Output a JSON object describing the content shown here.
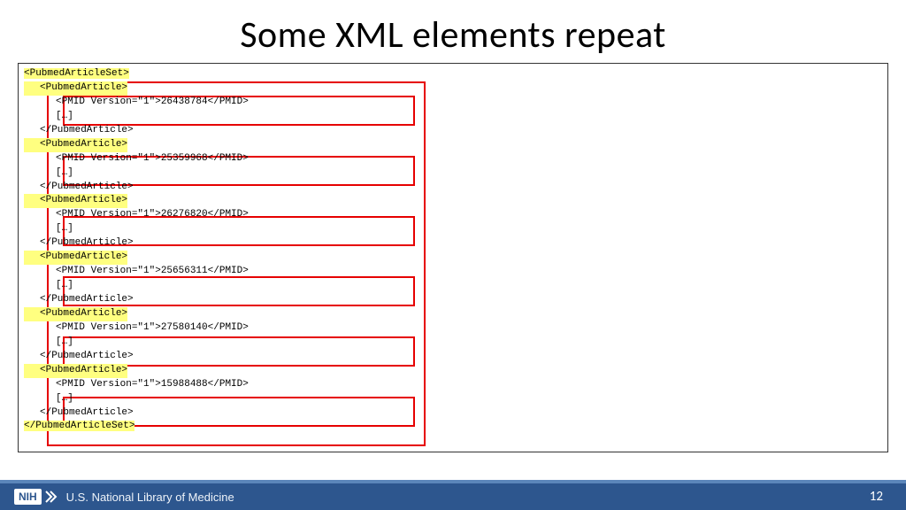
{
  "title": "Some XML elements repeat",
  "xml": {
    "setOpen": "<PubmedArticleSet>",
    "setClose": "</PubmedArticleSet>",
    "articleOpen": "<PubmedArticle>",
    "articleClose": "</PubmedArticle>",
    "pmidOpen": "<PMID Version=\"1\">",
    "pmidClose": "</PMID>",
    "ellipsis": "[…]",
    "pmids": [
      "26438784",
      "25359968",
      "26276820",
      "25656311",
      "27580140",
      "15988488"
    ]
  },
  "footer": {
    "logoText": "NIH",
    "orgText": "U.S. National Library of Medicine",
    "pageNumber": "12"
  }
}
